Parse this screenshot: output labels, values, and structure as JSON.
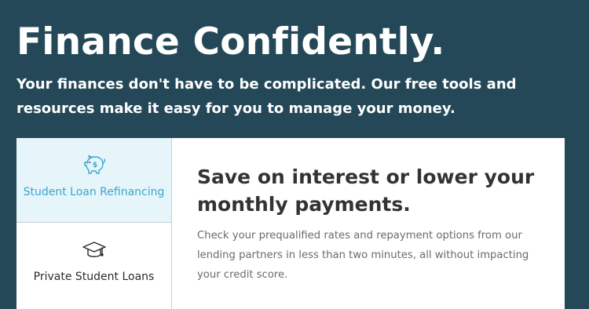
{
  "hero": {
    "title": "Finance Confidently.",
    "subtitle": "Your finances don't have to be complicated. Our free tools and resources make it easy for you to manage your money."
  },
  "tabs": [
    {
      "label": "Student Loan Refinancing",
      "icon": "piggy-bank-icon",
      "active": true,
      "color": "#3aa6cf"
    },
    {
      "label": "Private Student Loans",
      "icon": "graduation-cap-icon",
      "active": false,
      "color": "#2b2b2b"
    }
  ],
  "content": {
    "heading": "Save on interest or lower your monthly payments.",
    "body": "Check your prequalified rates and repayment options from our lending partners in less than two minutes, all without impacting your credit score."
  },
  "colors": {
    "background": "#244858",
    "active_tab_bg": "#e5f5fa",
    "accent": "#3aa6cf"
  }
}
